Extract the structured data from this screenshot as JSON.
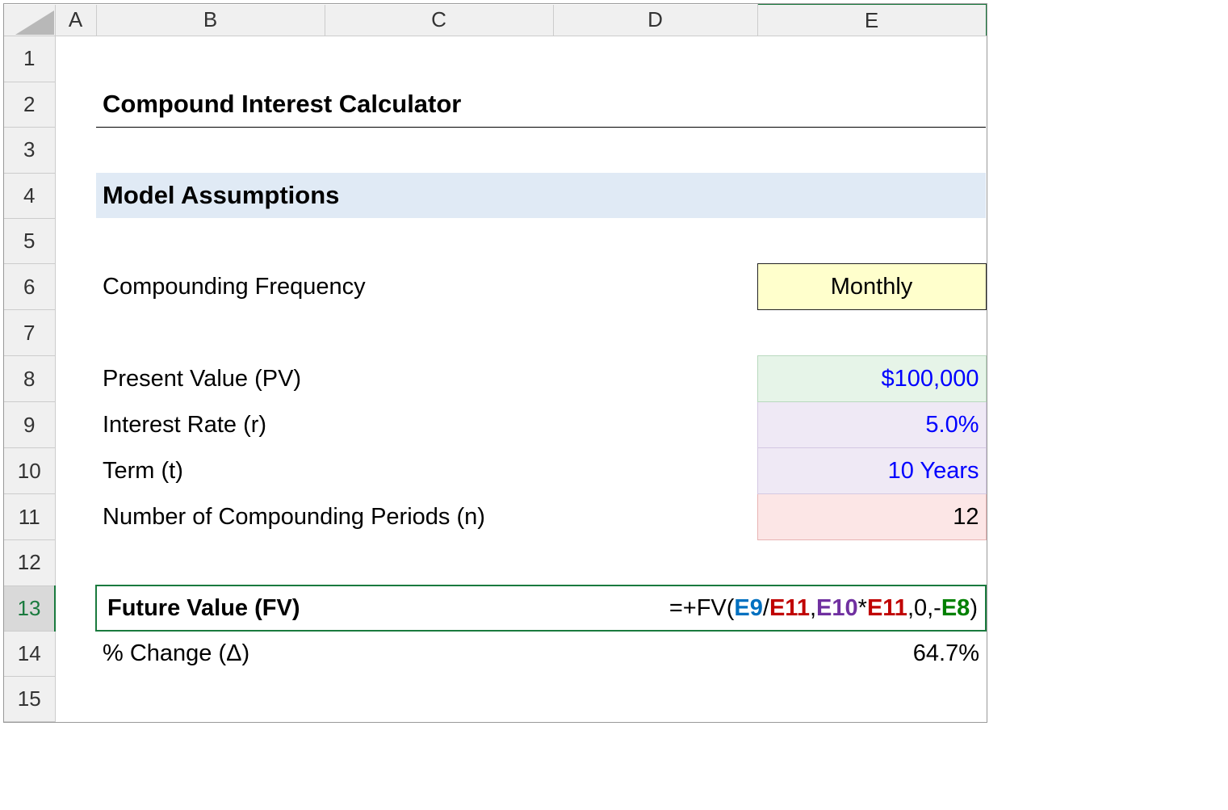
{
  "columns": [
    "A",
    "B",
    "C",
    "D",
    "E"
  ],
  "rows": [
    "1",
    "2",
    "3",
    "4",
    "5",
    "6",
    "7",
    "8",
    "9",
    "10",
    "11",
    "12",
    "13",
    "14",
    "15"
  ],
  "title": "Compound Interest Calculator",
  "subheader": "Model Assumptions",
  "labels": {
    "frequency": "Compounding Frequency",
    "pv": "Present Value (PV)",
    "rate": "Interest Rate (r)",
    "term": "Term (t)",
    "periods": "Number of Compounding Periods (n)",
    "fv": "Future Value (FV)",
    "change": "% Change (Δ)"
  },
  "values": {
    "frequency": "Monthly",
    "pv": "$100,000",
    "rate": "5.0%",
    "term": "10 Years",
    "periods": "12",
    "change": "64.7%"
  },
  "formula": {
    "prefix": "=+FV(",
    "p1": "E9",
    "slash": "/",
    "p2": "E11",
    "comma1": ",",
    "p3": "E10",
    "star": "*",
    "p4": "E11",
    "mid": ",0,-",
    "p5": "E8",
    "suffix": ")"
  }
}
